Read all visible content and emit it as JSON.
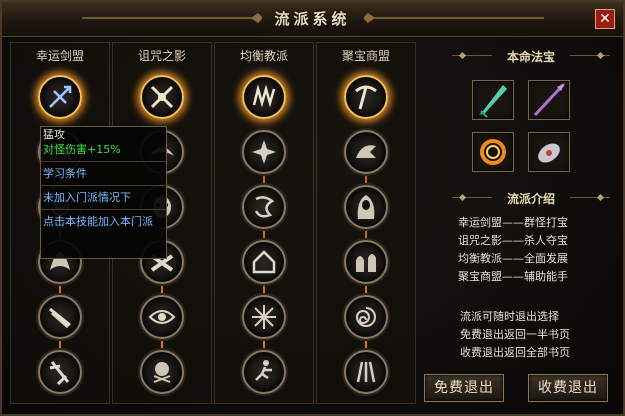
{
  "window": {
    "title": "流派系统",
    "close_label": "✕"
  },
  "columns": [
    {
      "name": "幸运剑盟",
      "icons": [
        "sword-cross-icon",
        "dragon-claw-icon",
        "spiral-slash-icon",
        "flame-wing-icon",
        "sword-slash-icon",
        "blade-strike-icon"
      ]
    },
    {
      "name": "诅咒之影",
      "icons": [
        "crossed-blades-icon",
        "shadow-wing-icon",
        "ghost-mask-icon",
        "crossed-fists-icon",
        "evil-eye-icon",
        "skull-cross-icon"
      ]
    },
    {
      "name": "均衡教派",
      "icons": [
        "clawed-beast-icon",
        "star-shard-icon",
        "rune-glyph-icon",
        "house-rune-icon",
        "star-burst-icon",
        "running-figure-icon"
      ]
    },
    {
      "name": "聚宝商盟",
      "icons": [
        "pickaxe-icon",
        "dragon-breath-icon",
        "hooded-figure-icon",
        "ghost-pair-icon",
        "swirl-vortex-icon",
        "claw-trident-icon"
      ]
    }
  ],
  "tooltip": {
    "skill_name": "猛攻",
    "effect": "对怪伤害+15%",
    "requirement": "学习条件",
    "join_status": "未加入门派情况下",
    "hint": "点击本技能加入本门派"
  },
  "right_panel": {
    "treasure_header": "本命法宝",
    "treasures": [
      "jade-dagger-icon",
      "shadow-spear-icon",
      "flame-ring-icon",
      "silver-gauntlet-icon"
    ],
    "intro_header": "流派介绍",
    "intro_lines": [
      "幸运剑盟——群怪打宝",
      "诅咒之影——杀人夺宝",
      "均衡教派——全面发展",
      "聚宝商盟——辅助能手"
    ],
    "rules_lines": [
      "流派可随时退出选择",
      "免费退出返回一半书页",
      "收费退出返回全部书页"
    ],
    "free_exit_label": "免费退出",
    "paid_exit_label": "收费退出"
  },
  "colors": {
    "accent": "#e07a18",
    "tooltip_green": "#3ee23e",
    "tooltip_blue": "#7ab8ff",
    "close_red": "#9b1c10"
  }
}
